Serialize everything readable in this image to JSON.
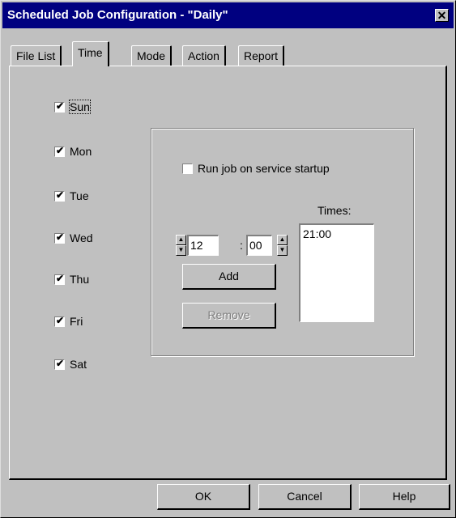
{
  "window": {
    "title": "Scheduled Job Configuration - \"Daily\"",
    "close_symbol": "✕"
  },
  "tabs": [
    {
      "label": "File List"
    },
    {
      "label": "Time"
    },
    {
      "label": "Mode"
    },
    {
      "label": "Action"
    },
    {
      "label": "Report"
    }
  ],
  "active_tab": "Time",
  "days": [
    {
      "label": "Sun",
      "checked": true
    },
    {
      "label": "Mon",
      "checked": true
    },
    {
      "label": "Tue",
      "checked": true
    },
    {
      "label": "Wed",
      "checked": true
    },
    {
      "label": "Thu",
      "checked": true
    },
    {
      "label": "Fri",
      "checked": true
    },
    {
      "label": "Sat",
      "checked": true
    }
  ],
  "startup": {
    "label": "Run job on service startup",
    "checked": false
  },
  "time_input": {
    "hour": "12",
    "minute": "00",
    "separator": ":"
  },
  "times": {
    "label": "Times:",
    "items": [
      "21:00"
    ]
  },
  "buttons": {
    "add": "Add",
    "remove": "Remove",
    "ok": "OK",
    "cancel": "Cancel",
    "help": "Help"
  },
  "icons": {
    "check": "✔",
    "spin_up": "▲",
    "spin_down": "▼"
  }
}
